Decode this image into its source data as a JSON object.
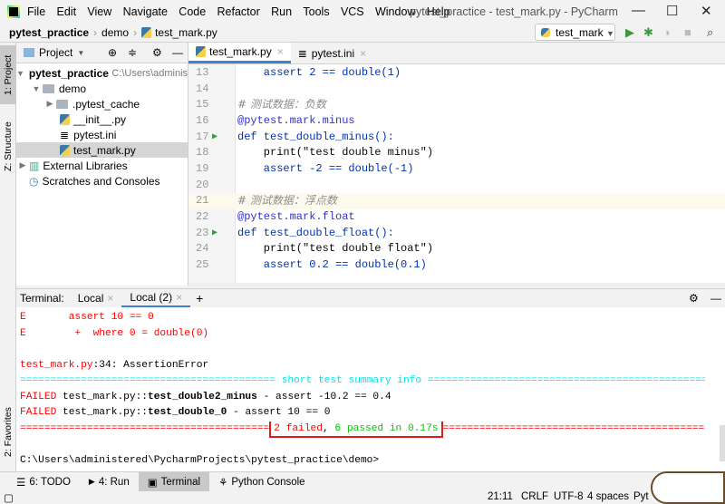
{
  "window": {
    "title": "pytest_practice - test_mark.py - PyCharm",
    "menu": [
      "File",
      "Edit",
      "View",
      "Navigate",
      "Code",
      "Refactor",
      "Run",
      "Tools",
      "VCS",
      "Window",
      "Help"
    ]
  },
  "breadcrumb": [
    "pytest_practice",
    "demo",
    "test_mark.py"
  ],
  "run_config": "test_mark",
  "left_tabs": {
    "project": "1: Project",
    "structure": "Z: Structure",
    "favorites": "2: Favorites"
  },
  "project": {
    "header": "Project",
    "tree": [
      {
        "label": "pytest_practice",
        "path": "C:\\Users\\adminis"
      },
      {
        "label": "demo"
      },
      {
        "label": ".pytest_cache"
      },
      {
        "label": "__init__.py"
      },
      {
        "label": "pytest.ini"
      },
      {
        "label": "test_mark.py"
      },
      {
        "label": "External Libraries"
      },
      {
        "label": "Scratches and Consoles"
      }
    ]
  },
  "editor": {
    "tabs": [
      "test_mark.py",
      "pytest.ini"
    ],
    "lines": [
      {
        "n": "13",
        "code": "    assert 2 == double(1)"
      },
      {
        "n": "14",
        "code": ""
      },
      {
        "n": "15",
        "code": "# 测试数据：负数"
      },
      {
        "n": "16",
        "code": "@pytest.mark.minus"
      },
      {
        "n": "17",
        "code": "def test_double_minus():"
      },
      {
        "n": "18",
        "code": "    print(\"test double minus\")"
      },
      {
        "n": "19",
        "code": "    assert -2 == double(-1)"
      },
      {
        "n": "20",
        "code": ""
      },
      {
        "n": "21",
        "code": "# 测试数据：浮点数"
      },
      {
        "n": "22",
        "code": "@pytest.mark.float"
      },
      {
        "n": "23",
        "code": "def test_double_float():"
      },
      {
        "n": "24",
        "code": "    print(\"test double float\")"
      },
      {
        "n": "25",
        "code": "    assert 0.2 == double(0.1)"
      }
    ]
  },
  "terminal": {
    "label": "Terminal:",
    "tabs": [
      "Local",
      "Local (2)"
    ],
    "e1": "E       assert 10 == 0",
    "e2": "E        +  where 0 = double(0)",
    "err_file": "test_mark.py",
    "err_rest": ":34: AssertionError",
    "sep_left": "==========================================",
    "summary_title": " short test summary info ",
    "sep_right": "===================================================",
    "f1": {
      "tag": "FAILED",
      "file": "test_mark.py::",
      "test": "test_double2_minus",
      "msg": " - assert -10.2 == 0.4"
    },
    "f2": {
      "tag": "FAILED",
      "file": "test_mark.py::",
      "test": "test_double_0",
      "msg": " - assert 10 == 0"
    },
    "res_left": "=========================================",
    "res_failed": "2 failed",
    "res_comma": ", ",
    "res_passed": "6 passed in 0.17s",
    "res_right": "===================================================",
    "prompt": "C:\\Users\\administered\\PycharmProjects\\pytest_practice\\demo>"
  },
  "bottom_tabs": [
    "6: TODO",
    "4: Run",
    "Terminal",
    "Python Console"
  ],
  "status": {
    "position": "21:11",
    "line_sep": "CRLF",
    "encoding": "UTF-8",
    "indent": "4 spaces",
    "interpreter": "Pyt"
  }
}
